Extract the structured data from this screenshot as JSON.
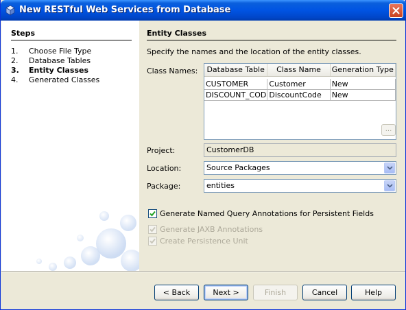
{
  "window": {
    "title": "New RESTful Web Services from Database"
  },
  "steps": {
    "heading": "Steps",
    "items": [
      {
        "num": "1.",
        "label": "Choose File Type"
      },
      {
        "num": "2.",
        "label": "Database Tables"
      },
      {
        "num": "3.",
        "label": "Entity Classes"
      },
      {
        "num": "4.",
        "label": "Generated Classes"
      }
    ],
    "current": 3
  },
  "panel": {
    "heading": "Entity Classes",
    "description": "Specify the names and the location of the entity classes.",
    "class_names_label": "Class Names:",
    "table": {
      "columns": [
        "Database Table",
        "Class Name",
        "Generation Type"
      ],
      "rows": [
        [
          "CUSTOMER",
          "Customer",
          "New"
        ],
        [
          "DISCOUNT_CODE",
          "DiscountCode",
          "New"
        ]
      ]
    },
    "browse_button_label": "...",
    "project_label": "Project:",
    "project_value": "CustomerDB",
    "location_label": "Location:",
    "location_value": "Source Packages",
    "package_label": "Package:",
    "package_value": "entities",
    "checkboxes": [
      {
        "label": "Generate Named Query Annotations for Persistent Fields",
        "checked": true,
        "enabled": true
      },
      {
        "label": "Generate JAXB Annotations",
        "checked": true,
        "enabled": false
      },
      {
        "label": "Create Persistence Unit",
        "checked": true,
        "enabled": false
      }
    ]
  },
  "buttons": {
    "back": "< Back",
    "next": "Next >",
    "finish": "Finish",
    "cancel": "Cancel",
    "help": "Help"
  }
}
